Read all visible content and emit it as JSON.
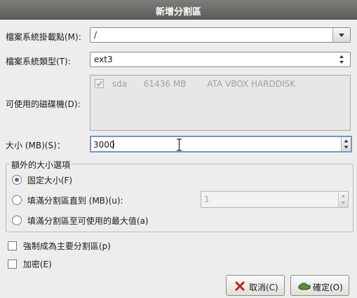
{
  "window": {
    "title": "新增分割區"
  },
  "form": {
    "mount_point": {
      "label": "檔案系統掛載點(M):",
      "value": "/"
    },
    "fs_type": {
      "label": "檔案系統類型(T):",
      "value": "ext3"
    },
    "drives": {
      "label": "可使用的磁碟機(D):",
      "items": [
        {
          "name": "sda",
          "size": "61436 MB",
          "model": "ATA VBOX HARDDISK",
          "checked": true
        }
      ]
    },
    "size": {
      "label": "大小 (MB)(S)：",
      "value": "3000"
    },
    "size_options": {
      "legend": "額外的大小選項",
      "fixed": {
        "label": "固定大小(F)",
        "selected": true
      },
      "fill_upto": {
        "label": "填滿分割區直到 (MB)(u):",
        "value": "1",
        "selected": false
      },
      "fill_max": {
        "label": "填滿分割區至可使用的最大值(a)",
        "selected": false
      }
    },
    "force_primary": {
      "label": "強制成為主要分割區(p)",
      "checked": false
    },
    "encrypt": {
      "label": "加密(E)",
      "checked": false
    }
  },
  "buttons": {
    "cancel": "取消(C)",
    "ok": "確定(O)"
  }
}
